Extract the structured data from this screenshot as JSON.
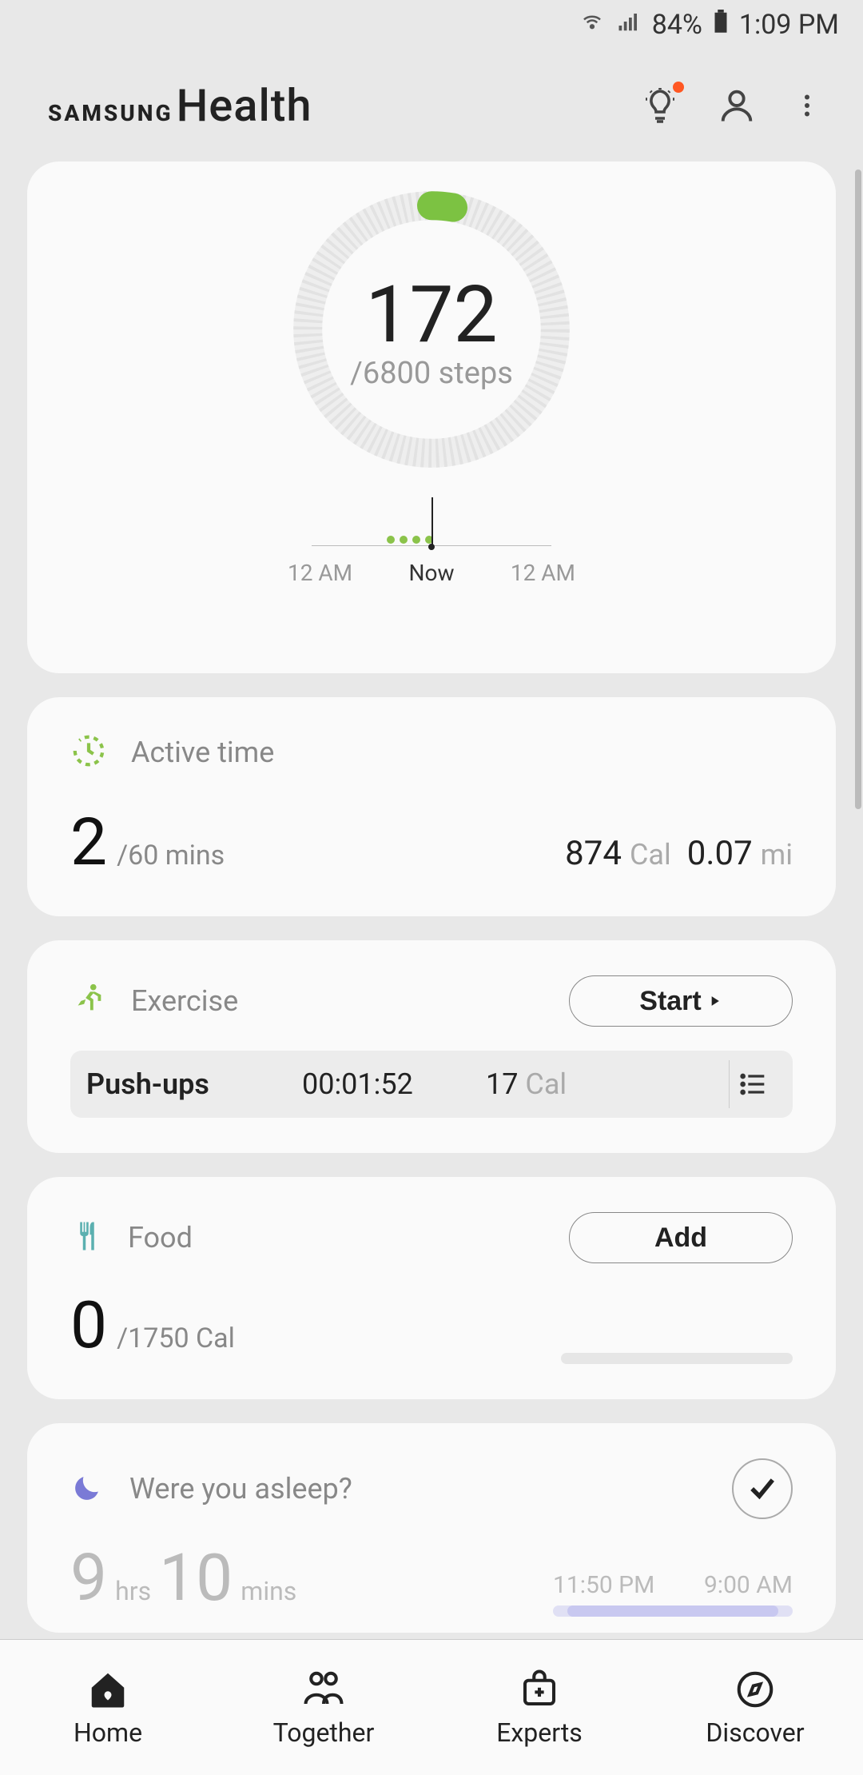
{
  "status_bar": {
    "battery_pct": "84%",
    "time": "1:09 PM"
  },
  "header": {
    "brand": "SAMSUNG",
    "app": "Health"
  },
  "steps": {
    "value": "172",
    "goal_text": "/6800 steps",
    "timeline": {
      "left": "12 AM",
      "center": "Now",
      "right": "12 AM"
    },
    "progress_fraction": 0.025
  },
  "active": {
    "title": "Active time",
    "value": "2",
    "goal": "/60 mins",
    "calories": {
      "v": "874",
      "u": "Cal"
    },
    "distance": {
      "v": "0.07",
      "u": "mi"
    }
  },
  "exercise": {
    "title": "Exercise",
    "start_label": "Start",
    "last": {
      "name": "Push-ups",
      "duration": "00:01:52",
      "cal_v": "17",
      "cal_u": "Cal"
    }
  },
  "food": {
    "title": "Food",
    "add_label": "Add",
    "value": "0",
    "goal": "/1750 Cal"
  },
  "sleep": {
    "title": "Were you asleep?",
    "hours": "9",
    "hours_u": "hrs",
    "mins": "10",
    "mins_u": "mins",
    "from": "11:50 PM",
    "to": "9:00 AM"
  },
  "nav": {
    "home": "Home",
    "together": "Together",
    "experts": "Experts",
    "discover": "Discover"
  }
}
